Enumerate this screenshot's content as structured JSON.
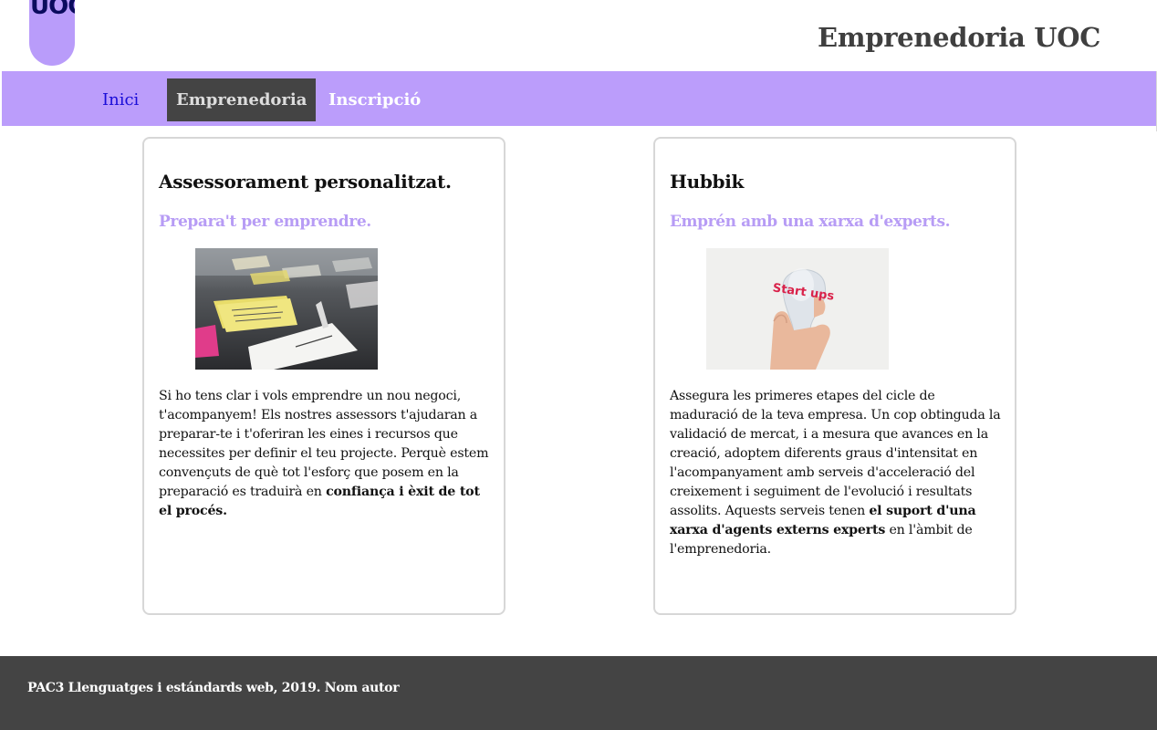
{
  "header": {
    "logo_text": "UOC",
    "site_title": "Emprenedoria UOC"
  },
  "nav": {
    "items": [
      {
        "label": "Inici"
      },
      {
        "label": "Emprenedoria"
      },
      {
        "label": "Inscripció"
      }
    ]
  },
  "cards": [
    {
      "title": "Assessorament personalitzat.",
      "subtitle": "Prepara't per emprendre.",
      "image_icon": "sticky-notes-photo",
      "body_before": "Si ho tens clar i vols emprendre un nou negoci, t'acompanyem! Els nostres assessors t'ajudaran a preparar-te i t'oferiran les eines i recursos que necessites per definir el teu projecte. Perquè estem convençuts de què tot l'esforç que posem en la preparació es traduirà en ",
      "body_bold": "confiança i èxit de tot el procés.",
      "body_after": ""
    },
    {
      "title": "Hubbik",
      "subtitle": "Emprén amb una xarxa d'experts.",
      "image_icon": "startup-lightbulb-photo",
      "image_text": "Start ups",
      "body_before": "Assegura les primeres etapes del cicle de maduració de la teva empresa. Un cop obtinguda la validació de mercat, i a mesura que avances en la creació, adoptem diferents graus d'intensitat en l'acompanyament amb serveis d'acceleració del creixement i seguiment de l'evolució i resultats assolits. Aquests serveis tenen ",
      "body_bold": "el suport d'una xarxa d'agents externs experts",
      "body_after": " en l'àmbit de l'emprenedoria."
    }
  ],
  "footer": {
    "text": "PAC3 Llenguatges i estándards web, 2019.",
    "author": "Nom autor"
  },
  "colors": {
    "accent": "#bb9dfb",
    "subtitle": "#b79cf5",
    "dark": "#444444",
    "link": "#1a0dd8"
  }
}
